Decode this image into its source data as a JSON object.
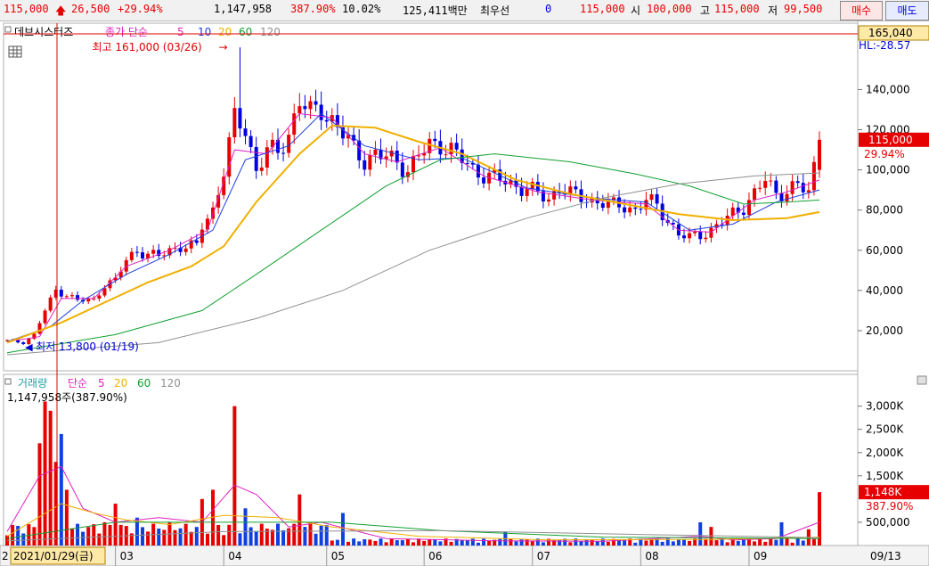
{
  "quote": {
    "price": "115,000",
    "change": "26,500",
    "change_pct": "+29.94%",
    "volume": "1,147,958",
    "volume_ratio": "387.90%",
    "turnover": "10.02%",
    "amount": "125,411백만",
    "priority_label": "최우선",
    "priority_value": "0",
    "bid_price": "115,000",
    "open_label": "시",
    "open": "100,000",
    "high_label": "고",
    "high": "115,000",
    "low_label": "저",
    "low": "99,500",
    "buy_label": "매수",
    "sell_label": "매도",
    "colors": {
      "up": "#e60000",
      "down": "#0000e0"
    }
  },
  "price_panel": {
    "stock_name": "데브시스터즈",
    "legend_prefix": "종가 단순",
    "ma_periods": [
      "5",
      "10",
      "20",
      "60",
      "120"
    ],
    "ma_colors": [
      "#e020c0",
      "#1d3de0",
      "#f0b000",
      "#10a030",
      "#909090"
    ],
    "high_marker": "최고 161,000 (03/26)",
    "high_arrow": "→",
    "low_marker": "최저 13,800 (01/19)",
    "low_arrow": "◀",
    "crosshair_value": "165,040",
    "crosshair_note": "HL:-28.57",
    "current_price_tag": "115,000",
    "current_pct_tag": "29.94%",
    "ticks": [
      "140,000",
      "120,000",
      "100,000",
      "80,000",
      "60,000",
      "40,000",
      "20,000"
    ],
    "table_icon": "grid-icon"
  },
  "volume_panel": {
    "title": "거래량",
    "legend_prefix": "단순",
    "ma_periods": [
      "5",
      "20",
      "60",
      "120"
    ],
    "ma_colors": [
      "#e020c0",
      "#f0b000",
      "#10a030",
      "#909090"
    ],
    "summary": "1,147,958주(387.90%)",
    "current_tag": "1,148K",
    "current_pct_tag": "387.90%",
    "ticks": [
      "3,000K",
      "2,500K",
      "2,000K",
      "1,500K",
      "500,000"
    ],
    "scroll_icon": "panel-minimize-icon"
  },
  "date_axis": {
    "cursor_date": "2021/01/29(금)",
    "cursor_prefix": "2",
    "months": [
      "03",
      "04",
      "05",
      "06",
      "07",
      "08",
      "09"
    ],
    "last_date": "09/13"
  },
  "chart_data": {
    "type": "candlestick",
    "price_axis": {
      "min": 0,
      "max": 165040,
      "ticks": [
        20000,
        40000,
        60000,
        80000,
        100000,
        120000,
        140000
      ]
    },
    "volume_axis": {
      "min": 0,
      "max": 3300000,
      "ticks": [
        500000,
        1500000,
        2000000,
        2500000,
        3000000
      ]
    },
    "month_starts": {
      "03": 20,
      "04": 40,
      "05": 59,
      "06": 77,
      "07": 97,
      "08": 117,
      "09": 137
    },
    "last_index": 150,
    "close_points": [
      [
        0,
        15000
      ],
      [
        3,
        14000
      ],
      [
        5,
        18000
      ],
      [
        7,
        30000
      ],
      [
        9,
        40000
      ],
      [
        11,
        38000
      ],
      [
        13,
        35000
      ],
      [
        16,
        35000
      ],
      [
        18,
        43000
      ],
      [
        20,
        45000
      ],
      [
        22,
        55000
      ],
      [
        24,
        60000
      ],
      [
        26,
        58000
      ],
      [
        28,
        57000
      ],
      [
        30,
        60000
      ],
      [
        32,
        62000
      ],
      [
        35,
        62000
      ],
      [
        36,
        72000
      ],
      [
        38,
        80000
      ],
      [
        40,
        100000
      ],
      [
        42,
        125000
      ],
      [
        44,
        120000
      ],
      [
        46,
        100000
      ],
      [
        48,
        110000
      ],
      [
        50,
        108000
      ],
      [
        52,
        118000
      ],
      [
        54,
        135000
      ],
      [
        56,
        128000
      ],
      [
        58,
        130000
      ],
      [
        60,
        125000
      ],
      [
        62,
        118000
      ],
      [
        64,
        110000
      ],
      [
        66,
        105000
      ],
      [
        68,
        108000
      ],
      [
        70,
        106000
      ],
      [
        72,
        104000
      ],
      [
        74,
        100000
      ],
      [
        76,
        107000
      ],
      [
        78,
        112000
      ],
      [
        80,
        113000
      ],
      [
        82,
        110000
      ],
      [
        84,
        105000
      ],
      [
        86,
        100000
      ],
      [
        88,
        98000
      ],
      [
        90,
        96000
      ],
      [
        92,
        94000
      ],
      [
        94,
        92000
      ],
      [
        96,
        91000
      ],
      [
        98,
        88000
      ],
      [
        100,
        85000
      ],
      [
        102,
        92000
      ],
      [
        104,
        88000
      ],
      [
        106,
        86000
      ],
      [
        108,
        85000
      ],
      [
        110,
        84000
      ],
      [
        112,
        82000
      ],
      [
        114,
        82000
      ],
      [
        116,
        80000
      ],
      [
        118,
        85000
      ],
      [
        120,
        82000
      ],
      [
        122,
        75000
      ],
      [
        124,
        68000
      ],
      [
        126,
        66000
      ],
      [
        128,
        68000
      ],
      [
        130,
        70000
      ],
      [
        132,
        74000
      ],
      [
        134,
        78000
      ],
      [
        136,
        82000
      ],
      [
        138,
        88000
      ],
      [
        140,
        95000
      ],
      [
        142,
        88000
      ],
      [
        144,
        90000
      ],
      [
        146,
        92000
      ],
      [
        148,
        88500
      ],
      [
        150,
        115000
      ]
    ],
    "ma_points": {
      "ma5": [
        [
          0,
          14500
        ],
        [
          6,
          17000
        ],
        [
          10,
          36000
        ],
        [
          16,
          36000
        ],
        [
          22,
          52000
        ],
        [
          30,
          60000
        ],
        [
          37,
          70000
        ],
        [
          42,
          110000
        ],
        [
          48,
          108000
        ],
        [
          54,
          128000
        ],
        [
          60,
          126000
        ],
        [
          66,
          108000
        ],
        [
          72,
          104000
        ],
        [
          80,
          111000
        ],
        [
          88,
          97000
        ],
        [
          98,
          89000
        ],
        [
          108,
          85000
        ],
        [
          118,
          83000
        ],
        [
          124,
          70000
        ],
        [
          130,
          69000
        ],
        [
          138,
          85000
        ],
        [
          144,
          89000
        ],
        [
          150,
          95000
        ]
      ],
      "ma10": [
        [
          0,
          14500
        ],
        [
          8,
          22000
        ],
        [
          14,
          35000
        ],
        [
          22,
          48000
        ],
        [
          30,
          58000
        ],
        [
          38,
          70000
        ],
        [
          44,
          105000
        ],
        [
          52,
          112000
        ],
        [
          58,
          128000
        ],
        [
          66,
          112000
        ],
        [
          76,
          105000
        ],
        [
          84,
          106000
        ],
        [
          96,
          91000
        ],
        [
          108,
          86000
        ],
        [
          118,
          84000
        ],
        [
          126,
          70000
        ],
        [
          134,
          73000
        ],
        [
          142,
          84000
        ],
        [
          150,
          90000
        ]
      ],
      "ma20": [
        [
          0,
          14000
        ],
        [
          10,
          24000
        ],
        [
          18,
          34000
        ],
        [
          26,
          44000
        ],
        [
          34,
          52000
        ],
        [
          40,
          62000
        ],
        [
          46,
          84000
        ],
        [
          54,
          108000
        ],
        [
          60,
          122000
        ],
        [
          68,
          121000
        ],
        [
          76,
          114000
        ],
        [
          84,
          108000
        ],
        [
          94,
          95000
        ],
        [
          104,
          88000
        ],
        [
          114,
          83000
        ],
        [
          124,
          78000
        ],
        [
          134,
          75000
        ],
        [
          144,
          76000
        ],
        [
          150,
          79000
        ]
      ],
      "ma60": [
        [
          0,
          9000
        ],
        [
          20,
          18000
        ],
        [
          36,
          30000
        ],
        [
          46,
          48000
        ],
        [
          58,
          70000
        ],
        [
          70,
          92000
        ],
        [
          80,
          105000
        ],
        [
          90,
          108000
        ],
        [
          104,
          104000
        ],
        [
          116,
          98000
        ],
        [
          126,
          92000
        ],
        [
          136,
          83000
        ],
        [
          144,
          84000
        ],
        [
          150,
          85000
        ]
      ],
      "ma120": [
        [
          0,
          8000
        ],
        [
          28,
          14000
        ],
        [
          46,
          26000
        ],
        [
          62,
          40000
        ],
        [
          78,
          60000
        ],
        [
          96,
          76000
        ],
        [
          110,
          86000
        ],
        [
          124,
          93000
        ],
        [
          138,
          97000
        ],
        [
          150,
          98500
        ]
      ]
    },
    "high": {
      "index": 43,
      "value": 161000,
      "date": "03/26"
    },
    "low": {
      "index": 2,
      "value": 13800,
      "date": "01/19"
    },
    "volume_spikes": [
      [
        6,
        2200000
      ],
      [
        7,
        3100000
      ],
      [
        8,
        2900000
      ],
      [
        9,
        1800000
      ],
      [
        10,
        2400000
      ],
      [
        11,
        1200000
      ],
      [
        18,
        500000
      ],
      [
        20,
        900000
      ],
      [
        24,
        600000
      ],
      [
        30,
        500000
      ],
      [
        36,
        1000000
      ],
      [
        38,
        1200000
      ],
      [
        42,
        3000000
      ],
      [
        44,
        800000
      ],
      [
        54,
        1100000
      ],
      [
        56,
        500000
      ],
      [
        62,
        700000
      ],
      [
        92,
        300000
      ],
      [
        128,
        500000
      ],
      [
        130,
        400000
      ],
      [
        143,
        500000
      ],
      [
        148,
        350000
      ],
      [
        150,
        1148000
      ]
    ],
    "volume_ma": {
      "ma5": [
        [
          0,
          300000
        ],
        [
          6,
          1500000
        ],
        [
          10,
          1700000
        ],
        [
          14,
          800000
        ],
        [
          20,
          500000
        ],
        [
          28,
          600000
        ],
        [
          36,
          500000
        ],
        [
          42,
          1300000
        ],
        [
          46,
          1100000
        ],
        [
          52,
          400000
        ],
        [
          58,
          500000
        ],
        [
          70,
          150000
        ],
        [
          90,
          100000
        ],
        [
          110,
          90000
        ],
        [
          128,
          200000
        ],
        [
          134,
          120000
        ],
        [
          142,
          150000
        ],
        [
          150,
          500000
        ]
      ],
      "ma20": [
        [
          0,
          200000
        ],
        [
          10,
          900000
        ],
        [
          16,
          700000
        ],
        [
          22,
          550000
        ],
        [
          30,
          450000
        ],
        [
          40,
          650000
        ],
        [
          50,
          600000
        ],
        [
          60,
          400000
        ],
        [
          76,
          200000
        ],
        [
          100,
          120000
        ],
        [
          130,
          130000
        ],
        [
          150,
          180000
        ]
      ],
      "ma60": [
        [
          0,
          150000
        ],
        [
          20,
          500000
        ],
        [
          40,
          500000
        ],
        [
          60,
          500000
        ],
        [
          80,
          320000
        ],
        [
          110,
          180000
        ],
        [
          150,
          150000
        ]
      ],
      "ma120": [
        [
          0,
          100000
        ],
        [
          40,
          300000
        ],
        [
          80,
          320000
        ],
        [
          120,
          230000
        ],
        [
          150,
          170000
        ]
      ]
    }
  }
}
